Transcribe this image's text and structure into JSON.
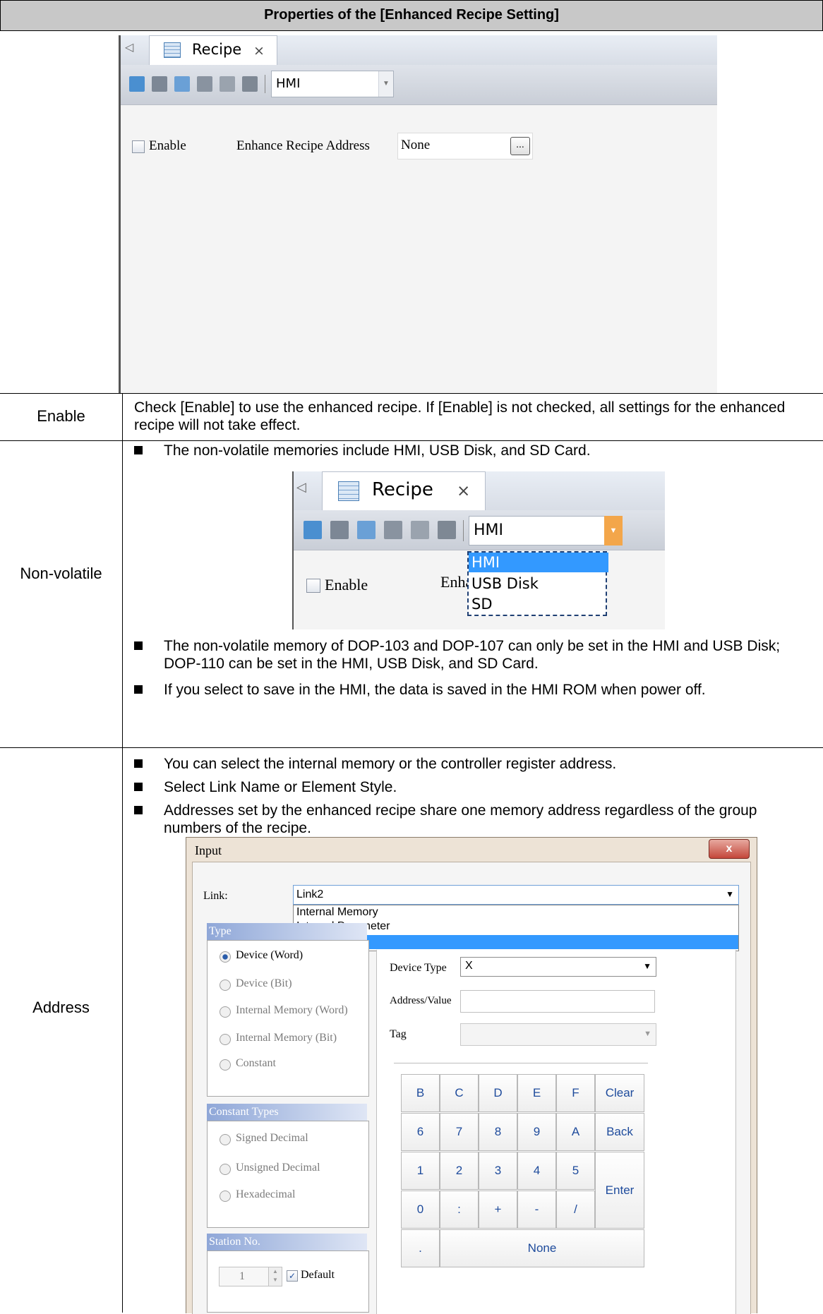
{
  "table": {
    "title": "Properties of the [Enhanced Recipe Setting]",
    "rows": {
      "enable": {
        "label": "Enable",
        "text": "Check [Enable] to use the enhanced recipe. If [Enable] is not checked, all settings for the enhanced recipe will not take effect."
      },
      "nonvolatile": {
        "label": "Non-volatile",
        "bullets": [
          "The non-volatile memories include HMI, USB Disk, and SD Card.",
          "The non-volatile memory of DOP-103 and DOP-107 can only be set in the HMI and USB Disk; DOP-110 can be set in the HMI, USB Disk, and SD Card.",
          "If you select to save in the HMI, the data is saved in the HMI ROM when power off."
        ]
      },
      "address": {
        "label": "Address",
        "bullets": [
          "You can select the internal memory or the controller register address.",
          "Select Link Name or Element Style.",
          "Addresses set by the enhanced recipe share one memory address regardless of the group numbers of the recipe."
        ]
      }
    }
  },
  "recipe_panel": {
    "tab_label": "Recipe",
    "tab_close": "×",
    "storage_value": "HMI",
    "enable_label": "Enable",
    "address_label": "Enhance Recipe Address",
    "address_value": "None",
    "browse_label": "...",
    "partial_address_label": "Enhanc",
    "storage_options": [
      "HMI",
      "USB Disk",
      "SD"
    ]
  },
  "input_dialog": {
    "title": "Input",
    "close": "x",
    "link_label": "Link:",
    "link_value": "Link2",
    "link_options": [
      "Internal Memory",
      "Internal Parameter",
      "Link2"
    ],
    "type_header": "Type",
    "type_options": [
      "Device (Word)",
      "Device (Bit)",
      "Internal Memory (Word)",
      "Internal Memory (Bit)",
      "Constant"
    ],
    "constant_header": "Constant Types",
    "constant_options": [
      "Signed Decimal",
      "Unsigned Decimal",
      "Hexadecimal"
    ],
    "station_header": "Station No.",
    "station_value": "1",
    "default_label": "Default",
    "device_type_label": "Device Type",
    "device_type_value": "X",
    "address_value_label": "Address/Value",
    "tag_label": "Tag",
    "keys": {
      "row1": [
        "B",
        "C",
        "D",
        "E",
        "F",
        "Clear"
      ],
      "row2": [
        "6",
        "7",
        "8",
        "9",
        "A",
        "Back"
      ],
      "row3": [
        "1",
        "2",
        "3",
        "4",
        "5"
      ],
      "row4": [
        "0",
        ":",
        "+",
        "-",
        "/"
      ],
      "enter": "Enter",
      "dot": ".",
      "none": "None"
    }
  },
  "colors": {
    "header_bg": "#c8c8c8",
    "selection": "#3399ff",
    "dashed_highlight": "#1f3f73",
    "key_text": "#1e4b9c"
  }
}
